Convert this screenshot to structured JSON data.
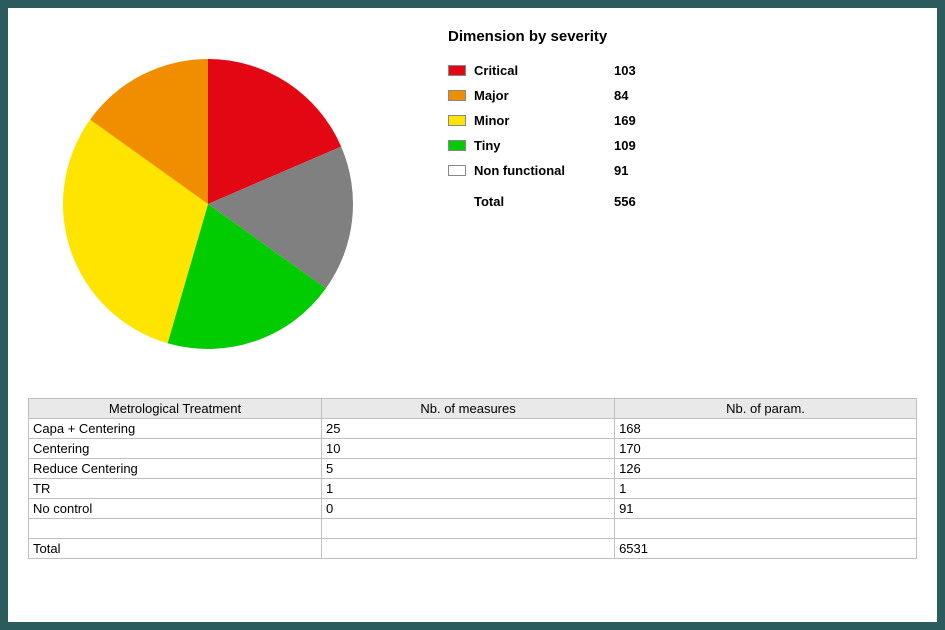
{
  "chart_data": {
    "type": "pie",
    "title": "Dimension by severity",
    "series": [
      {
        "name": "Critical",
        "value": 103,
        "color": "#e30613"
      },
      {
        "name": "Major",
        "value": 84,
        "color": "#f18e00"
      },
      {
        "name": "Minor",
        "value": 169,
        "color": "#ffe400"
      },
      {
        "name": "Tiny",
        "value": 109,
        "color": "#00cc00"
      },
      {
        "name": "Non functional",
        "value": 91,
        "color": "#ffffff",
        "slice_color": "#808080"
      }
    ],
    "total_label": "Total",
    "total_value": 556
  },
  "table": {
    "headers": [
      "Metrological Treatment",
      "Nb. of measures",
      "Nb. of param."
    ],
    "rows": [
      [
        "Capa + Centering",
        "25",
        "168"
      ],
      [
        "Centering",
        "10",
        "170"
      ],
      [
        "Reduce Centering",
        "5",
        "126"
      ],
      [
        "TR",
        "1",
        "1"
      ],
      [
        "No control",
        "0",
        "91"
      ],
      [
        "",
        "",
        ""
      ],
      [
        "Total",
        "",
        "6531"
      ]
    ]
  }
}
